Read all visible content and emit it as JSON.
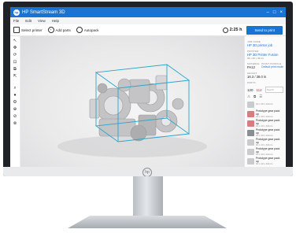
{
  "app": {
    "title": "HP SmartStream 3D",
    "logo_text": "hp"
  },
  "window_controls": {
    "minimize": "–",
    "maximize": "□",
    "close": "×"
  },
  "menu": {
    "items": [
      "File",
      "Edit",
      "View",
      "Help"
    ]
  },
  "toolbar": {
    "select_printer": "Select printer",
    "add_parts": "Add parts",
    "autopack": "Autopack",
    "print_time": "2:25 h",
    "send_to_print": "Send to print"
  },
  "left_tools": [
    "↖",
    "✥",
    "⟳",
    "⊡",
    "⧉",
    "⇱",
    "⌕",
    "●",
    "⚙",
    "⊕",
    "⊘",
    "⊗"
  ],
  "right_panel": {
    "job_name_label": "JOB NAME",
    "job_name": "HP 3D printer job",
    "printer_label": "PRINTER",
    "printer_name": "HP 3D Printer Fusion",
    "printer_dims": "38 x 28 x 38 cm",
    "material_label": "MATERIAL",
    "material": "PA12",
    "print_profile_label": "PRINT PROFILE",
    "print_profile": "Default print mode",
    "height_label": "HEIGHT",
    "height": "16.3 / 38.0 in",
    "parts_label": "PARTS",
    "count_total": "120",
    "count_red": "112",
    "search_placeholder": "Search",
    "parts": [
      {
        "name": "",
        "dims": "10 x 10 x 10mm",
        "thumb": "light"
      },
      {
        "name": "Prototype gear pack up",
        "dims": "10 x 10 x 10mm",
        "thumb": "red"
      },
      {
        "name": "Prototype gear pack up",
        "dims": "10 x 10 x 10mm",
        "thumb": "red"
      },
      {
        "name": "Prototype gear pack up",
        "dims": "10 x 10 x 10mm",
        "thumb": "dark"
      },
      {
        "name": "Prototype gear pack up",
        "dims": "10 x 10 x 10mm",
        "thumb": "light"
      },
      {
        "name": "Prototype gear pack up",
        "dims": "10 x 10 x 10mm",
        "thumb": "light"
      },
      {
        "name": "Prototype gear pack up",
        "dims": "10 x 10 x 10mm",
        "thumb": "light"
      }
    ]
  },
  "monitor": {
    "brand_logo": "hp"
  }
}
